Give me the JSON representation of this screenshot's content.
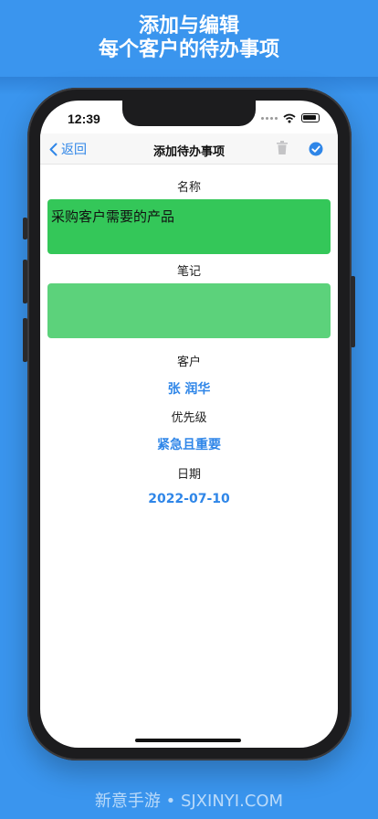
{
  "headline": {
    "line1": "添加与编辑",
    "line2": "每个客户的待办事项"
  },
  "status_bar": {
    "time": "12:39"
  },
  "nav": {
    "back_label": "返回",
    "title": "添加待办事项",
    "trash_icon": "trash-icon",
    "done_icon": "checkmark-circle-icon"
  },
  "form": {
    "name_label": "名称",
    "name_value": "采购客户需要的产品",
    "note_label": "笔记",
    "note_value": "",
    "customer_label": "客户",
    "customer_value": "张 润华",
    "priority_label": "优先级",
    "priority_value": "紧急且重要",
    "date_label": "日期",
    "date_value": "2022-07-10"
  },
  "colors": {
    "background": "#3a95ee",
    "name_field": "#34c759",
    "note_field": "#5cd27b",
    "accent": "#2f86e8"
  },
  "watermark": "新意手游 • SJXINYI.COM"
}
